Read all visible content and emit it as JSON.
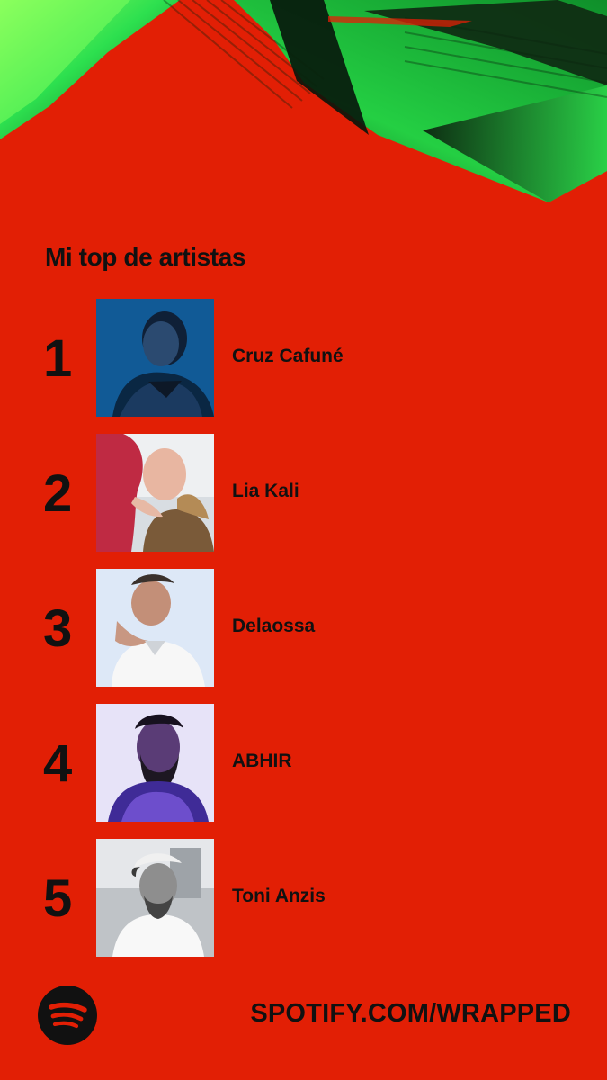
{
  "theme": {
    "background": "#e21f05",
    "text": "#111111",
    "accent_green": "#29d34c"
  },
  "header": {
    "title": "Mi top de artistas"
  },
  "artists": [
    {
      "rank": "1",
      "name": "Cruz Cafuné",
      "image_icon": "artist-portrait-blue-icon"
    },
    {
      "rank": "2",
      "name": "Lia Kali",
      "image_icon": "artist-portrait-light-icon"
    },
    {
      "rank": "3",
      "name": "Delaossa",
      "image_icon": "artist-portrait-white-shirt-icon"
    },
    {
      "rank": "4",
      "name": "ABHIR",
      "image_icon": "artist-portrait-purple-icon"
    },
    {
      "rank": "5",
      "name": "Toni Anzis",
      "image_icon": "artist-portrait-monochrome-icon"
    }
  ],
  "footer": {
    "logo_icon": "spotify-logo-icon",
    "url": "SPOTIFY.COM/WRAPPED"
  }
}
